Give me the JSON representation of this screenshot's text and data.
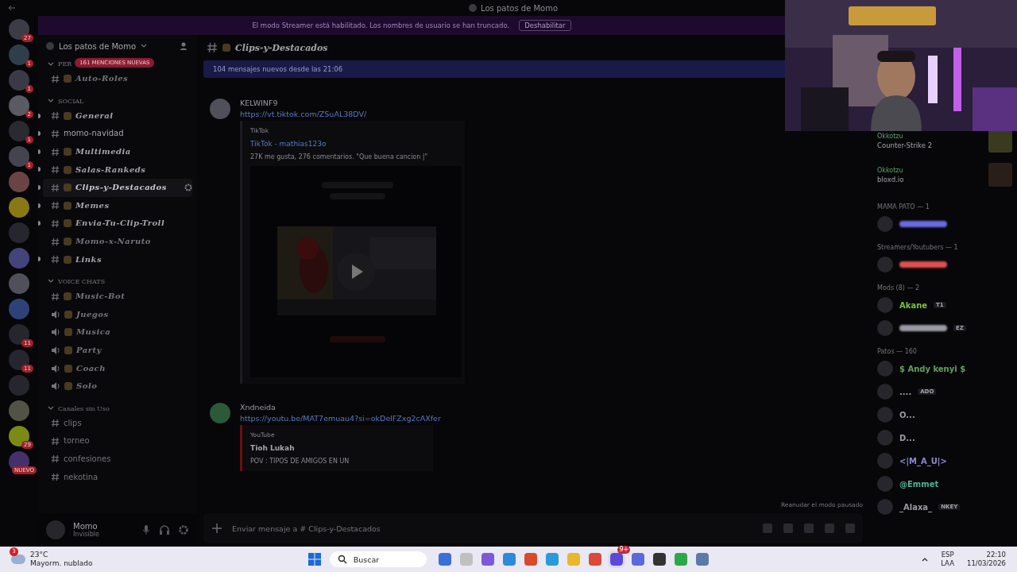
{
  "window": {
    "title": "Los patos de Momo"
  },
  "servers": [
    {
      "color": "#3c3c46",
      "badge": "27"
    },
    {
      "color": "#2e3e4a",
      "badge": "1"
    },
    {
      "color": "#3a3a46",
      "badge": "1"
    },
    {
      "color": "#5a5a62",
      "badge": "2"
    },
    {
      "color": "#2a2a32",
      "badge": "1"
    },
    {
      "color": "#44444e",
      "badge": "1"
    },
    {
      "color": "#6a4444"
    },
    {
      "color": "#8a7814"
    },
    {
      "color": "#26262e"
    },
    {
      "color": "#44447a"
    },
    {
      "color": "#50505a"
    },
    {
      "color": "#2e4278"
    },
    {
      "color": "#26262e",
      "badge": "11"
    },
    {
      "color": "#26262e",
      "badge": "11"
    },
    {
      "color": "#26262e"
    },
    {
      "color": "#525246"
    },
    {
      "color": "#7a8a14",
      "badge": "29"
    },
    {
      "color": "#44306a",
      "badge": "NUEVO"
    }
  ],
  "banner": {
    "text": "El modo Streamer está habilitado. Los nombres de usuario se han truncado.",
    "button": "Deshabilitar"
  },
  "sidebar": {
    "server_name": "Los patos de Momo",
    "mentions": "161 MENCIONES NUEVAS",
    "categories": [
      {
        "name": "PER",
        "channels": [
          {
            "name": "Auto-Roles",
            "kind": "text",
            "fancy": true,
            "unread": false,
            "selected": false
          }
        ]
      },
      {
        "name": "SOCIAL",
        "channels": [
          {
            "name": "General",
            "kind": "text",
            "fancy": true,
            "unread": true,
            "selected": false
          },
          {
            "name": "momo-navidad",
            "kind": "text",
            "fancy": false,
            "unread": true,
            "selected": false
          },
          {
            "name": "Multimedia",
            "kind": "text",
            "fancy": true,
            "unread": true,
            "selected": false
          },
          {
            "name": "Salas-Rankeds",
            "kind": "text",
            "fancy": true,
            "unread": true,
            "selected": false
          },
          {
            "name": "Clips-y-Destacados",
            "kind": "text",
            "fancy": true,
            "unread": true,
            "selected": true
          },
          {
            "name": "Memes",
            "kind": "text",
            "fancy": true,
            "unread": true,
            "selected": false
          },
          {
            "name": "Envia-Tu-Clip-Troll",
            "kind": "text",
            "fancy": true,
            "unread": true,
            "selected": false
          },
          {
            "name": "Momo-x-Naruto",
            "kind": "text",
            "fancy": true,
            "unread": false,
            "selected": false
          },
          {
            "name": "Links",
            "kind": "text",
            "fancy": true,
            "unread": true,
            "selected": false
          }
        ]
      },
      {
        "name": "VOICE CHATS",
        "channels": [
          {
            "name": "Music-Bot",
            "kind": "text",
            "fancy": true,
            "unread": false,
            "selected": false
          },
          {
            "name": "Juegos",
            "kind": "voice",
            "fancy": true,
            "unread": false,
            "selected": false
          },
          {
            "name": "Musica",
            "kind": "voice",
            "fancy": true,
            "unread": false,
            "selected": false
          },
          {
            "name": "Party",
            "kind": "voice",
            "fancy": true,
            "unread": false,
            "selected": false
          },
          {
            "name": "Coach",
            "kind": "voice",
            "fancy": true,
            "unread": false,
            "selected": false
          },
          {
            "name": "Solo",
            "kind": "voice",
            "fancy": true,
            "unread": false,
            "selected": false
          }
        ]
      },
      {
        "name": "Canales sin Uso",
        "channels": [
          {
            "name": "clips",
            "kind": "text",
            "fancy": false,
            "unread": false,
            "selected": false
          },
          {
            "name": "torneo",
            "kind": "text",
            "fancy": false,
            "unread": false,
            "selected": false
          },
          {
            "name": "confesiones",
            "kind": "text",
            "fancy": false,
            "unread": false,
            "selected": false
          },
          {
            "name": "nekotina",
            "kind": "text",
            "fancy": false,
            "unread": false,
            "selected": false
          }
        ]
      }
    ],
    "user": {
      "name": "Momo",
      "status": "Invisible"
    }
  },
  "chat": {
    "channel": "Clips-y-Destacados",
    "new_messages": "104 mensajes nuevos desde las 21:06",
    "messages": [
      {
        "author": "KELWINF9",
        "color": "#50505a",
        "link": "https://vt.tiktok.com/ZSuAL38DV/",
        "embed": {
          "kind": "video",
          "provider": "TikTok",
          "title": "TikTok - mathias123o",
          "description": "27K me gusta, 276 comentarios. \"Que buena cancion |\""
        }
      },
      {
        "author": "Xndneida",
        "color": "#2a5a38",
        "link": "https://youtu.be/MAT7emuau4?si=okDelFZxg2cAXfer",
        "embed": {
          "kind": "text",
          "provider": "YouTube",
          "title": "Tioh Lukah",
          "description": "POV : TIPOS DE AMIGOS EN UN"
        }
      }
    ],
    "resume": "Reanudar el modo pausado",
    "composer": {
      "placeholder": "Enviar mensaje a # Clips-y-Destacados"
    }
  },
  "members": {
    "activities": [
      {
        "user": "Okkotzu",
        "game": "Counter-Strike 2"
      },
      {
        "user": "Okkotzu",
        "game": "bloxd.io"
      }
    ],
    "groups": [
      {
        "name": "MAMA PATO — 1",
        "members": [
          {
            "color": "#6a6ae0"
          }
        ]
      },
      {
        "name": "Streamers/Youtubers — 1",
        "members": [
          {
            "color": "#e05050"
          }
        ]
      },
      {
        "name": "Mods (8) — 2",
        "members": [
          {
            "name": "Akane",
            "color": "#7ac040",
            "tag": "T1"
          },
          {
            "color": "#9a9aa4",
            "tag": "EZ"
          }
        ]
      },
      {
        "name": "Patos — 160",
        "members": [
          {
            "name": "$ Andy kenyi $",
            "color": "#60a060"
          },
          {
            "name": "....",
            "color": "#9a9aa4",
            "tag": "ADO"
          },
          {
            "name": "O...",
            "color": "#9a9aa4"
          },
          {
            "name": "D...",
            "color": "#9a9aa4"
          },
          {
            "name": "<|M_A_U|>",
            "color": "#8a8ad0"
          },
          {
            "name": "@Emmet",
            "color": "#50b090"
          },
          {
            "name": "_Alaxa_",
            "color": "#9a9aa4",
            "tag": "NKEY"
          }
        ]
      }
    ]
  },
  "taskbar": {
    "weather_badge": "3",
    "temperature": "23°C",
    "weather": "Mayorm. nublado",
    "search": "Buscar",
    "discord_badge": "9+",
    "lang": "ESP",
    "layout": "LAA",
    "time": "22:10",
    "date": "11/03/2026"
  }
}
